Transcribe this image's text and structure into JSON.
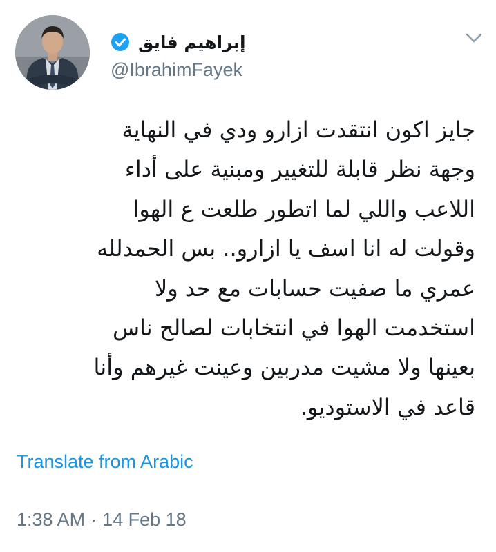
{
  "author": {
    "display_name": "إبراهيم فايق",
    "handle": "@IbrahimFayek",
    "verified": true
  },
  "tweet": {
    "text_lines": [
      "جايز اكون انتقدت ازارو ودي في النهاية",
      "وجهة نظر قابلة للتغيير ومبنية على أداء",
      "اللاعب واللي لما اتطور طلعت ع الهوا",
      "وقولت له انا اسف يا ازارو.. بس الحمدلله",
      "عمري ما صفيت حسابات مع حد ولا",
      "استخدمت الهوا في انتخابات لصالح ناس",
      "بعينها ولا مشيت مدربين وعينت غيرهم وأنا",
      "قاعد في الاستوديو."
    ]
  },
  "translate_label": "Translate from Arabic",
  "timestamp": {
    "time": "1:38 AM",
    "separator": "·",
    "date": "14 Feb 18"
  },
  "icons": {
    "verified": "verified-badge-icon",
    "caret": "chevron-down-icon"
  },
  "colors": {
    "link": "#1b95e0",
    "secondary_text": "#657786",
    "verified": "#1da1f2"
  }
}
